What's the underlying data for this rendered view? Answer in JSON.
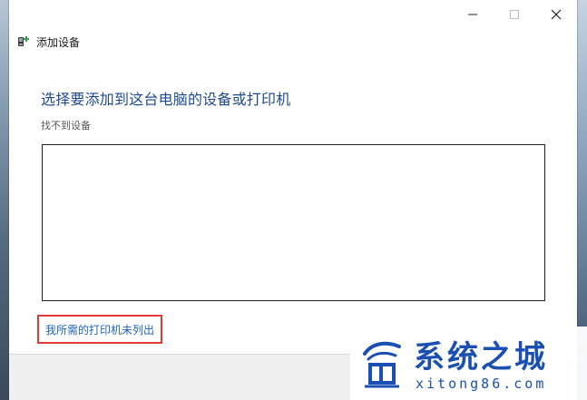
{
  "window": {
    "header_title": "添加设备",
    "controls": {
      "minimize_icon": "minimize-icon",
      "maximize_icon": "maximize-icon",
      "close_icon": "close-icon"
    }
  },
  "main": {
    "title": "选择要添加到这台电脑的设备或打印机",
    "status": "找不到设备",
    "device_list": [],
    "missing_printer_link": "我所需的打印机未列出"
  },
  "watermark": {
    "brand_cn": "系统之城",
    "brand_en": "xitong86.com"
  },
  "colors": {
    "title_blue": "#1f4b8e",
    "link_blue": "#1f63b8",
    "highlight_red": "#e53935",
    "watermark_blue": "#1b4fb2"
  }
}
